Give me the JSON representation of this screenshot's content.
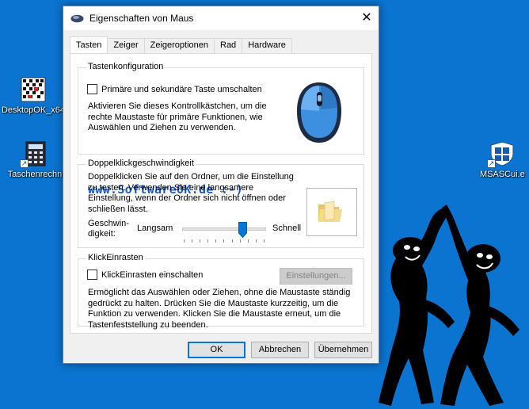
{
  "desktop": {
    "icons": [
      {
        "label": "DesktopOK_x64",
        "icon": "desktopok-icon"
      },
      {
        "label": "Taschenrechn",
        "icon": "calculator-icon"
      },
      {
        "label": "MSASCui.e",
        "icon": "defender-shield-icon"
      }
    ]
  },
  "dialog": {
    "title": "Eigenschaften von Maus",
    "close_glyph": "✕",
    "tabs": [
      {
        "label": "Tasten",
        "active": true
      },
      {
        "label": "Zeiger",
        "active": false
      },
      {
        "label": "Zeigeroptionen",
        "active": false
      },
      {
        "label": "Rad",
        "active": false
      },
      {
        "label": "Hardware",
        "active": false
      }
    ],
    "button_config": {
      "legend": "Tastenkonfiguration",
      "checkbox_label": "Primäre und sekundäre Taste umschalten",
      "checked": false,
      "description": "Aktivieren Sie dieses Kontrollkästchen, um die rechte Maustaste für primäre Funktionen, wie Auswählen und Ziehen zu verwenden."
    },
    "watermark": "www.SoftwareOK.de :-)",
    "double_click": {
      "legend": "Doppelklickgeschwindigkeit",
      "description": "Doppelklicken Sie auf den Ordner, um die Einstellung zu testen. Verwenden Sie eine langsamere Einstellung, wenn der Ordner sich nicht öffnen oder schließen lässt.",
      "speed_label_1": "Geschwin-",
      "speed_label_2": "digkeit:",
      "slow_label": "Langsam",
      "fast_label": "Schnell",
      "slider_value_fraction": 0.75
    },
    "click_lock": {
      "legend": "KlickEinrasten",
      "checkbox_label": "KlickEinrasten einschalten",
      "checked": false,
      "settings_button": "Einstellungen...",
      "description": "Ermöglicht das Auswählen oder Ziehen, ohne die Maustaste ständig gedrückt zu halten. Drücken Sie die Maustaste kurzzeitig, um die Funktion zu verwenden. Klicken Sie die Maustaste erneut, um die Tastenfeststellung zu beenden."
    },
    "footer": {
      "ok": "OK",
      "cancel": "Abbrechen",
      "apply": "Übernehmen"
    }
  },
  "colors": {
    "desktop_bg": "#0a74d0",
    "accent": "#0078d7",
    "watermark": "#1a5ac9"
  }
}
